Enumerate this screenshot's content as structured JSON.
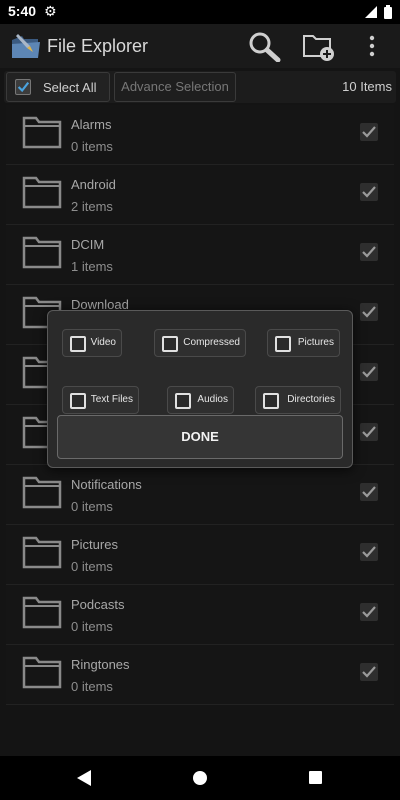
{
  "status": {
    "time": "5:40"
  },
  "appbar": {
    "title": "File Explorer"
  },
  "selection": {
    "select_all": "Select All",
    "advance": "Advance Selection",
    "count": "10 Items"
  },
  "folders": [
    {
      "name": "Alarms",
      "items": "0 items"
    },
    {
      "name": "Android",
      "items": "2 items"
    },
    {
      "name": "DCIM",
      "items": "1 items"
    },
    {
      "name": "Download",
      "items": ""
    },
    {
      "name": "",
      "items": ""
    },
    {
      "name": "",
      "items": ""
    },
    {
      "name": "Notifications",
      "items": "0 items"
    },
    {
      "name": "Pictures",
      "items": "0 items"
    },
    {
      "name": "Podcasts",
      "items": "0 items"
    },
    {
      "name": "Ringtones",
      "items": "0 items"
    }
  ],
  "dialog": {
    "options": [
      "Video",
      "Compressed",
      "Pictures",
      "Text Files",
      "Audios",
      "Directories"
    ],
    "done": "DONE"
  },
  "colors": {
    "background": "#141414",
    "accent": "#4aa3df"
  }
}
